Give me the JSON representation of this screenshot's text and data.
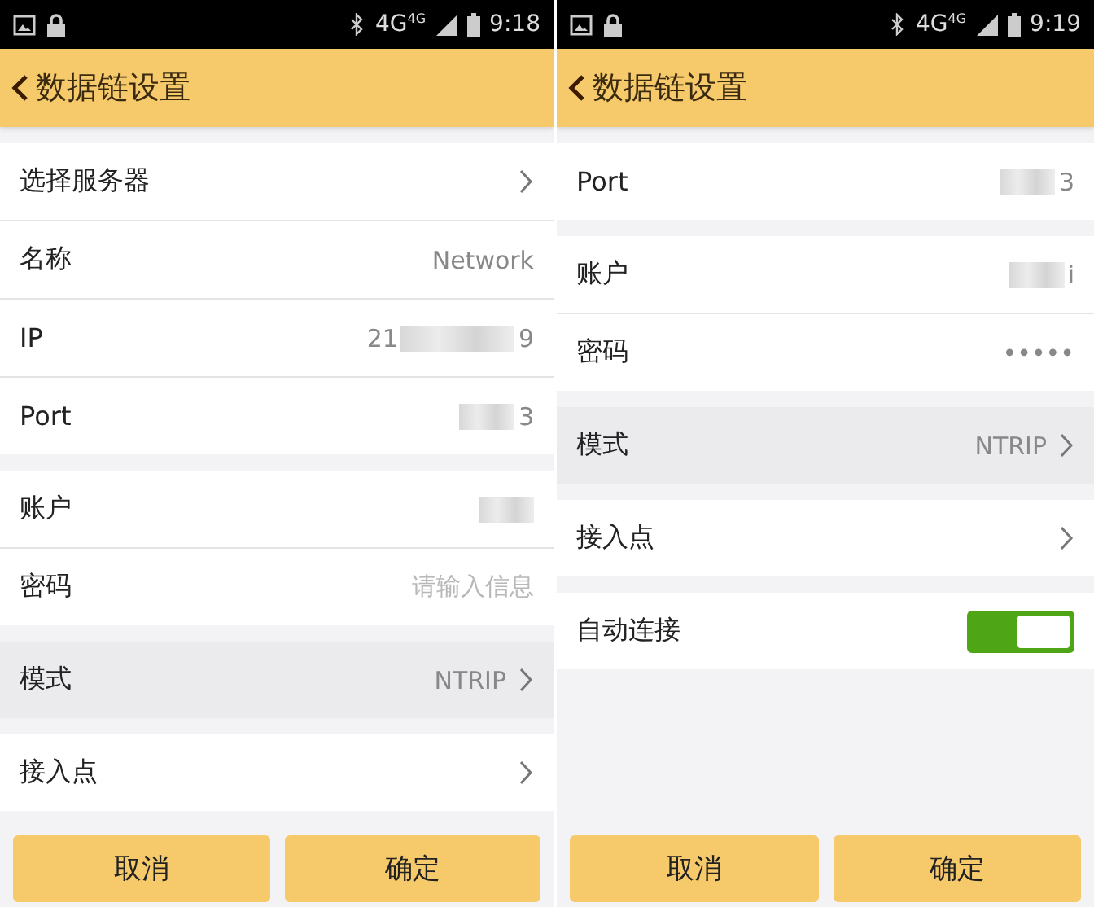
{
  "screens": [
    {
      "status_bar": {
        "network": "4G",
        "network_small": "4G",
        "time": "9:18"
      },
      "title": "数据链设置",
      "back": true,
      "groups": [
        {
          "rows": [
            {
              "kind": "chevron",
              "label": "选择服务器",
              "highlighted": false
            },
            {
              "kind": "value",
              "label": "名称",
              "value": "Network",
              "highlighted": false
            },
            {
              "kind": "value",
              "label": "IP",
              "value": "21",
              "value_end": "9",
              "redacted": true,
              "highlighted": false
            },
            {
              "kind": "value",
              "label": "Port",
              "value_end": "3",
              "redacted": true,
              "highlighted": false
            }
          ]
        },
        {
          "rows": [
            {
              "kind": "value",
              "label": "账户",
              "redacted": true,
              "highlighted": false
            },
            {
              "kind": "value",
              "label": "密码",
              "placeholder": "请输入信息",
              "highlighted": false
            }
          ]
        },
        {
          "rows": [
            {
              "kind": "chevron",
              "label": "模式",
              "value": "NTRIP",
              "highlighted": true
            }
          ]
        },
        {
          "rows": [
            {
              "kind": "chevron",
              "label": "接入点",
              "highlighted": false
            }
          ]
        }
      ],
      "buttons": [
        "取消",
        "确定"
      ]
    },
    {
      "status_bar": {
        "network": "4G",
        "network_small": "4G",
        "time": "9:19"
      },
      "title": "数据链设置",
      "back": true,
      "groups": [
        {
          "rows": [
            {
              "kind": "value",
              "label": "Port",
              "value_end": "3",
              "redacted": true,
              "highlighted": false
            }
          ]
        },
        {
          "rows": [
            {
              "kind": "value",
              "label": "账户",
              "value_end": "i",
              "redacted": true,
              "highlighted": false
            },
            {
              "kind": "value",
              "label": "密码",
              "value": "•••••",
              "highlighted": false
            }
          ]
        },
        {
          "rows": [
            {
              "kind": "chevron",
              "label": "模式",
              "value": "NTRIP",
              "highlighted": true
            }
          ]
        },
        {
          "rows": [
            {
              "kind": "chevron",
              "label": "接入点",
              "highlighted": false
            }
          ]
        },
        {
          "rows": [
            {
              "kind": "toggle",
              "label": "自动连接",
              "on": true,
              "highlighted": false
            }
          ]
        }
      ],
      "buttons": [
        "取消",
        "确定"
      ]
    }
  ]
}
